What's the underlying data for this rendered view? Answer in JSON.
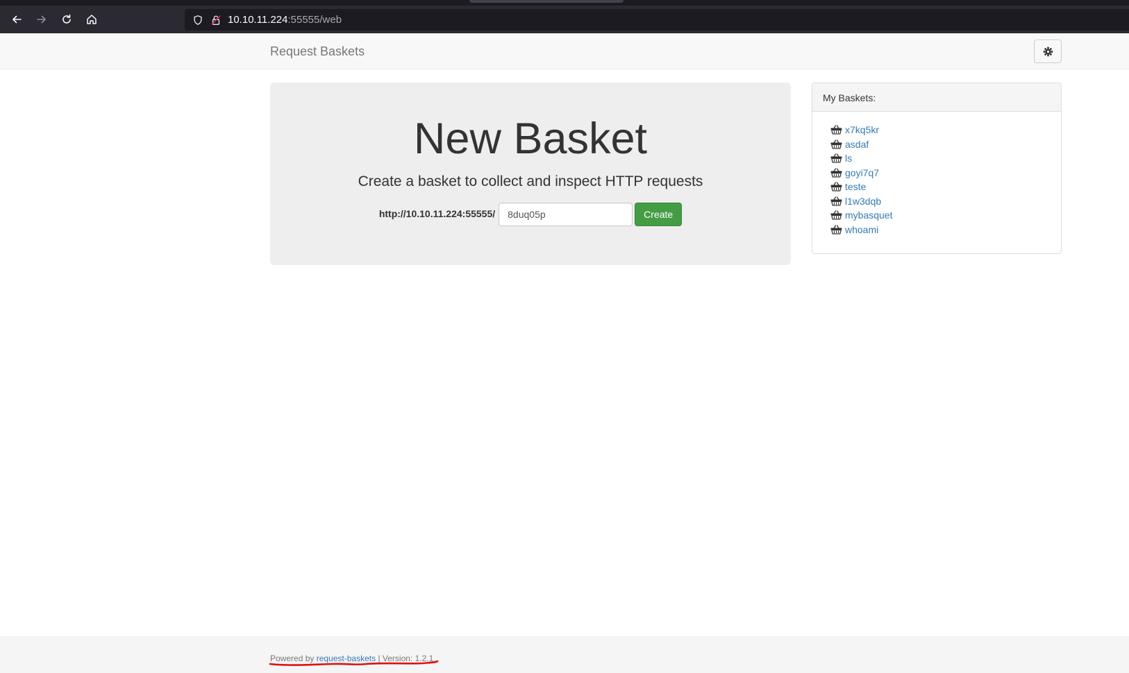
{
  "browser": {
    "url_host": "10.10.11.224",
    "url_path": ":55555/web"
  },
  "navbar": {
    "brand": "Request Baskets",
    "settings_icon": "gear-icon"
  },
  "hero": {
    "title": "New Basket",
    "subtitle": "Create a basket to collect and inspect HTTP requests",
    "base_url": "http://10.10.11.224:55555/",
    "basket_name_value": "8duq05p",
    "create_label": "Create"
  },
  "baskets_panel": {
    "heading": "My Baskets:",
    "items": [
      "x7kq5kr",
      "asdaf",
      "ls",
      "goyi7q7",
      "teste",
      "l1w3dqb",
      "mybasquet",
      "whoami"
    ],
    "icon": "basket-icon"
  },
  "footer": {
    "powered_by": "Powered by",
    "link_label": "request-baskets",
    "separator": "| Version:",
    "version": "1.2.1"
  },
  "colors": {
    "link": "#337ab7",
    "create_button": "#449d44",
    "annotation": "#e01010"
  }
}
